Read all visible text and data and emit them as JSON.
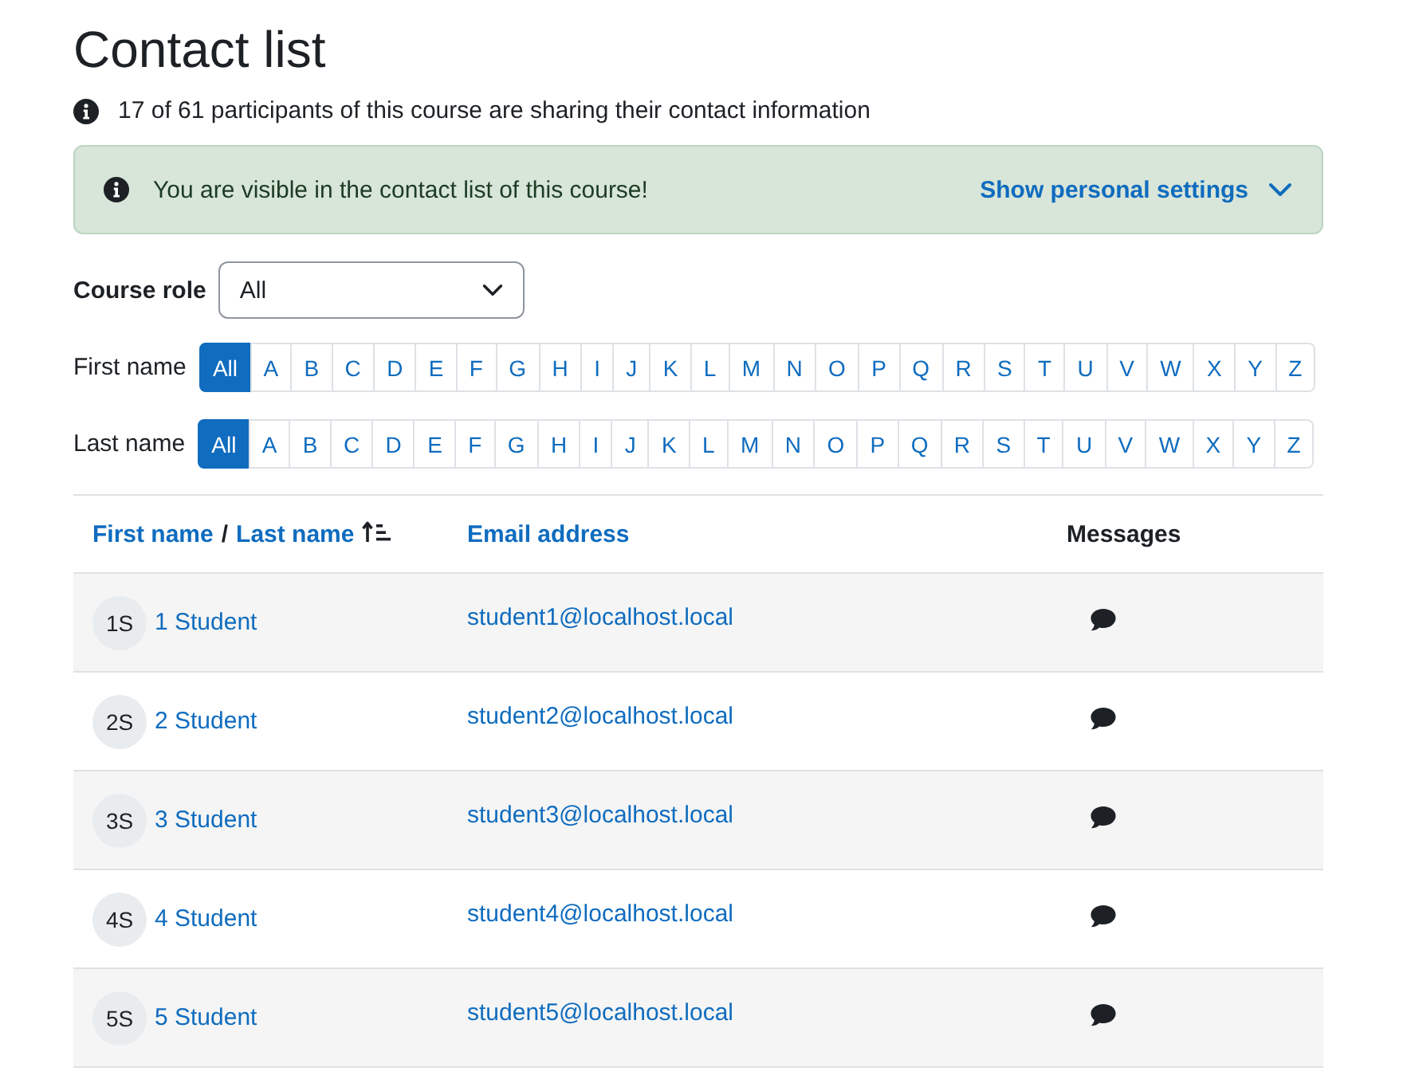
{
  "page": {
    "title": "Contact list"
  },
  "summary": {
    "text": "17 of 61 participants of this course are sharing their contact information"
  },
  "alert": {
    "message": "You are visible in the contact list of this course!",
    "toggle": {
      "label": "Show personal settings",
      "expanded": false
    }
  },
  "filters": {
    "course_role": {
      "label": "Course role",
      "value": "All"
    },
    "initials_bars": [
      {
        "label": "First name",
        "options": [
          {
            "label": "All",
            "selected": true
          },
          {
            "label": "A",
            "selected": false
          },
          {
            "label": "B",
            "selected": false
          },
          {
            "label": "C",
            "selected": false
          },
          {
            "label": "D",
            "selected": false
          },
          {
            "label": "E",
            "selected": false
          },
          {
            "label": "F",
            "selected": false
          },
          {
            "label": "G",
            "selected": false
          },
          {
            "label": "H",
            "selected": false
          },
          {
            "label": "I",
            "selected": false
          },
          {
            "label": "J",
            "selected": false
          },
          {
            "label": "K",
            "selected": false
          },
          {
            "label": "L",
            "selected": false
          },
          {
            "label": "M",
            "selected": false
          },
          {
            "label": "N",
            "selected": false
          },
          {
            "label": "O",
            "selected": false
          },
          {
            "label": "P",
            "selected": false
          },
          {
            "label": "Q",
            "selected": false
          },
          {
            "label": "R",
            "selected": false
          },
          {
            "label": "S",
            "selected": false
          },
          {
            "label": "T",
            "selected": false
          },
          {
            "label": "U",
            "selected": false
          },
          {
            "label": "V",
            "selected": false
          },
          {
            "label": "W",
            "selected": false
          },
          {
            "label": "X",
            "selected": false
          },
          {
            "label": "Y",
            "selected": false
          },
          {
            "label": "Z",
            "selected": false
          }
        ]
      },
      {
        "label": "Last name",
        "options": [
          {
            "label": "All",
            "selected": true
          },
          {
            "label": "A",
            "selected": false
          },
          {
            "label": "B",
            "selected": false
          },
          {
            "label": "C",
            "selected": false
          },
          {
            "label": "D",
            "selected": false
          },
          {
            "label": "E",
            "selected": false
          },
          {
            "label": "F",
            "selected": false
          },
          {
            "label": "G",
            "selected": false
          },
          {
            "label": "H",
            "selected": false
          },
          {
            "label": "I",
            "selected": false
          },
          {
            "label": "J",
            "selected": false
          },
          {
            "label": "K",
            "selected": false
          },
          {
            "label": "L",
            "selected": false
          },
          {
            "label": "M",
            "selected": false
          },
          {
            "label": "N",
            "selected": false
          },
          {
            "label": "O",
            "selected": false
          },
          {
            "label": "P",
            "selected": false
          },
          {
            "label": "Q",
            "selected": false
          },
          {
            "label": "R",
            "selected": false
          },
          {
            "label": "S",
            "selected": false
          },
          {
            "label": "T",
            "selected": false
          },
          {
            "label": "U",
            "selected": false
          },
          {
            "label": "V",
            "selected": false
          },
          {
            "label": "W",
            "selected": false
          },
          {
            "label": "X",
            "selected": false
          },
          {
            "label": "Y",
            "selected": false
          },
          {
            "label": "Z",
            "selected": false
          }
        ]
      }
    ]
  },
  "table": {
    "columns": [
      {
        "kind": "sortable_pair",
        "separator": "/",
        "links": [
          {
            "label": "First name",
            "sorted": false
          },
          {
            "label": "Last name",
            "sorted": true
          }
        ]
      },
      {
        "kind": "link",
        "label": "Email address"
      },
      {
        "kind": "plain",
        "label": "Messages"
      }
    ],
    "rows": [
      {
        "initials": "1S",
        "name": "1 Student",
        "email": "student1@localhost.local"
      },
      {
        "initials": "2S",
        "name": "2 Student",
        "email": "student2@localhost.local"
      },
      {
        "initials": "3S",
        "name": "3 Student",
        "email": "student3@localhost.local"
      },
      {
        "initials": "4S",
        "name": "4 Student",
        "email": "student4@localhost.local"
      },
      {
        "initials": "5S",
        "name": "5 Student",
        "email": "student5@localhost.local"
      }
    ]
  }
}
